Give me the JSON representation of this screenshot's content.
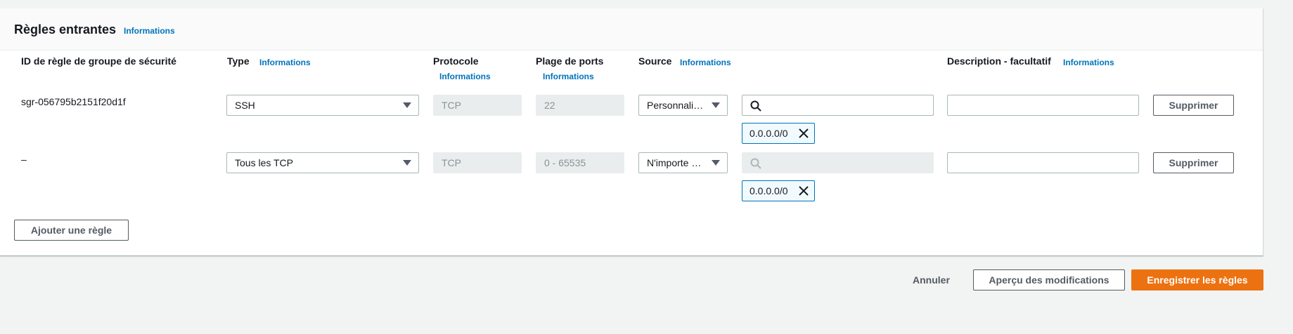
{
  "panel": {
    "title": "Règles entrantes",
    "info_label": "Informations"
  },
  "columns": {
    "rule_id": "ID de règle de groupe de sécurité",
    "type": "Type",
    "type_info": "Informations",
    "protocol": "Protocole",
    "protocol_info": "Informations",
    "port_range": "Plage de ports",
    "port_range_info": "Informations",
    "source": "Source",
    "source_info": "Informations",
    "description": "Description - facultatif",
    "description_info": "Informations"
  },
  "rules": [
    {
      "id": "sgr-056795b2151f20d1f",
      "type": "SSH",
      "protocol": "TCP",
      "port_range": "22",
      "source_type": "Personnalis…",
      "source_search": "",
      "source_token": "0.0.0.0/0",
      "description": "",
      "delete_label": "Supprimer"
    },
    {
      "id": "–",
      "type": "Tous les TCP",
      "protocol": "TCP",
      "port_range": "0 - 65535",
      "source_type": "N'importe …",
      "source_search": "",
      "source_token": "0.0.0.0/0",
      "description": "",
      "delete_label": "Supprimer"
    }
  ],
  "add_rule_label": "Ajouter une règle",
  "footer": {
    "cancel_label": "Annuler",
    "preview_label": "Aperçu des modifications",
    "save_label": "Enregistrer les règles"
  },
  "colors": {
    "accent": "#0073bb",
    "primary_button": "#ec7211",
    "page_bg": "#f2f3f3"
  }
}
